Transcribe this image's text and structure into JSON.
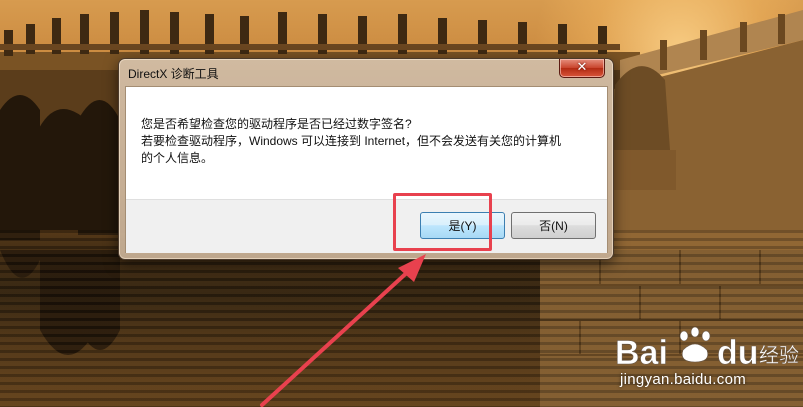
{
  "dialog": {
    "title": "DirectX 诊断工具",
    "message_lines": [
      "您是否希望检查您的驱动程序是否已经过数字签名?",
      "若要检查驱动程序，Windows 可以连接到 Internet，但不会发送有关您的计算机",
      "的个人信息。"
    ],
    "close_icon": "close-x-icon",
    "buttons": {
      "yes": "是(Y)",
      "no": "否(N)"
    }
  },
  "colors": {
    "annotation_red": "#e8414e",
    "close_button_red": "#c8432b",
    "default_button_blue": "#3c7fb1"
  },
  "watermark": {
    "brand": "Baidu 经验",
    "url": "jingyan.baidu.com"
  }
}
